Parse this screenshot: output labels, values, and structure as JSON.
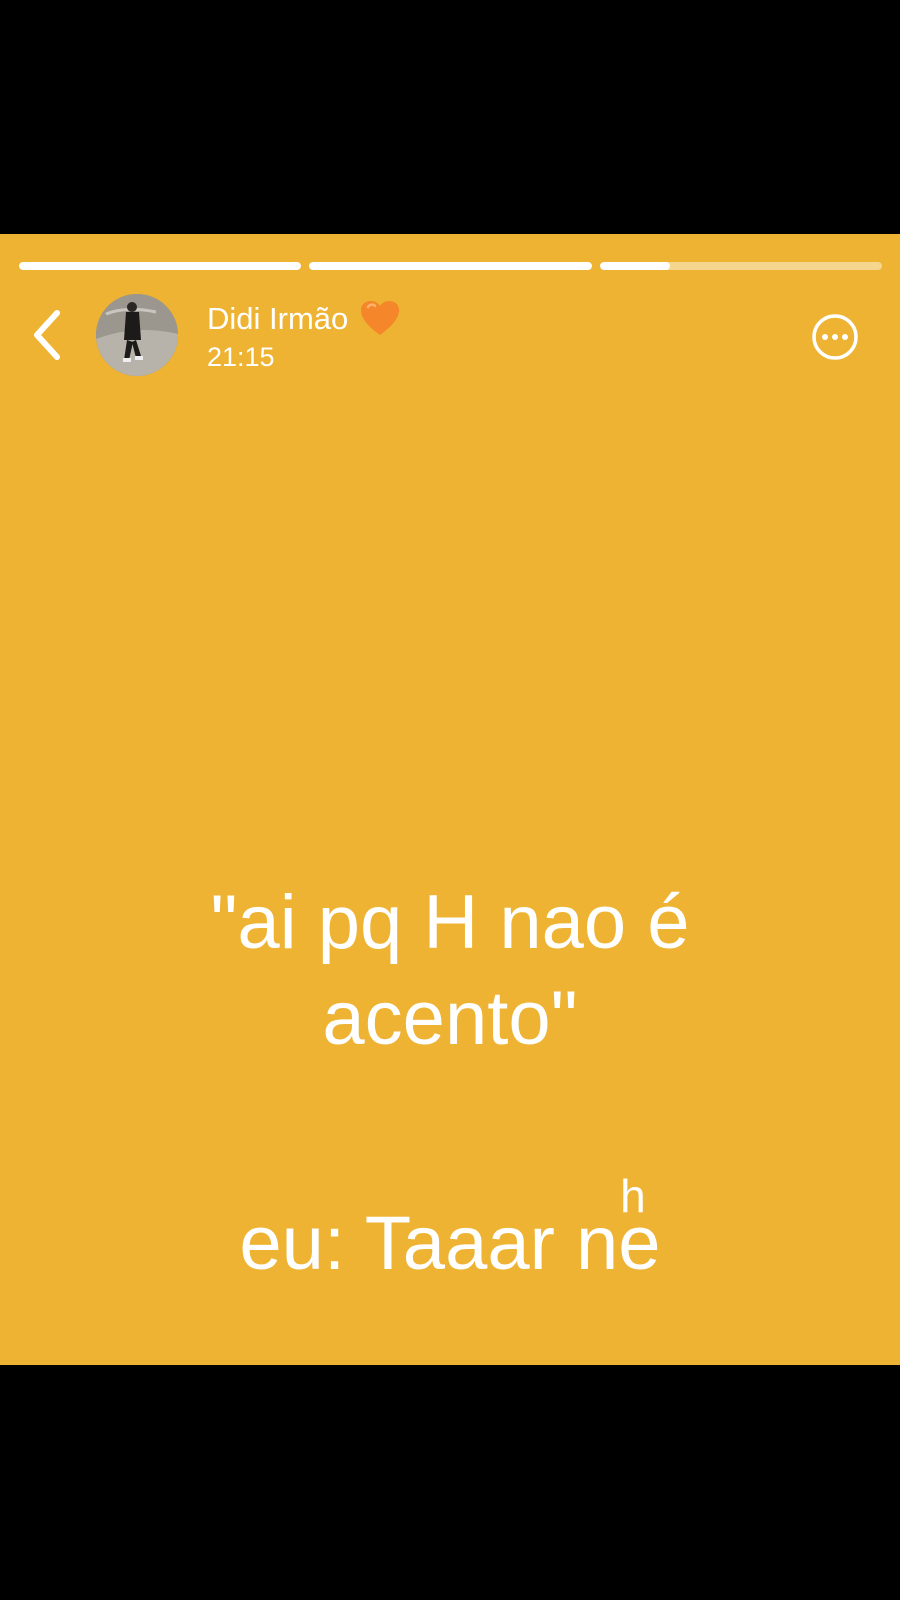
{
  "story": {
    "background_color": "#EEB332",
    "segments": [
      {
        "progress": 1.0
      },
      {
        "progress": 1.0
      },
      {
        "progress": 0.25
      }
    ]
  },
  "header": {
    "back_icon": "chevron-left-icon",
    "username": "Didi Irmão",
    "heart_emoji": "🧡",
    "time": "21:15",
    "more_icon": "more-horizontal-icon"
  },
  "content": {
    "caption_line1": "\"ai pq H nao é",
    "caption_line2": "acento\"",
    "reply_prefix": "eu: Taaar n",
    "reply_e": "e",
    "reply_sup": "h"
  }
}
